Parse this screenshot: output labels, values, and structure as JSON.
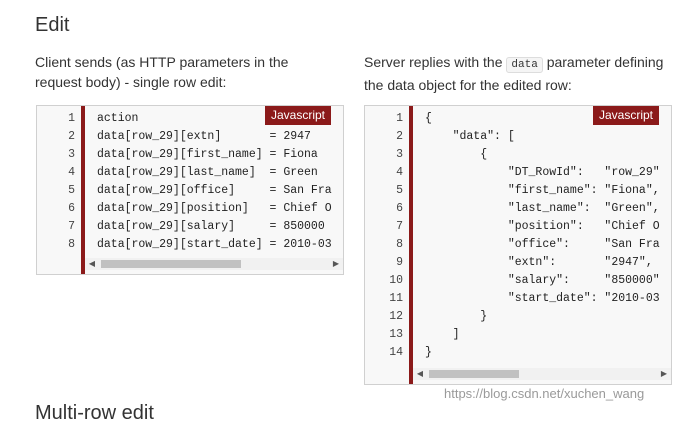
{
  "title": "Edit",
  "left": {
    "description": "Client sends (as HTTP parameters in the request body) - single row edit:",
    "badge": "Javascript",
    "lines": [
      {
        "n": "1",
        "t": "action"
      },
      {
        "n": "2",
        "t": "data[row_29][extn]       = 2947"
      },
      {
        "n": "3",
        "t": "data[row_29][first_name] = Fiona"
      },
      {
        "n": "4",
        "t": "data[row_29][last_name]  = Green"
      },
      {
        "n": "5",
        "t": "data[row_29][office]     = San Fra"
      },
      {
        "n": "6",
        "t": "data[row_29][position]   = Chief O"
      },
      {
        "n": "7",
        "t": "data[row_29][salary]     = 850000"
      },
      {
        "n": "8",
        "t": "data[row_29][start_date] = 2010-03"
      }
    ]
  },
  "right": {
    "description_pre": "Server replies with the ",
    "description_code": "data",
    "description_post": " parameter defining the data object for the edited row:",
    "badge": "Javascript",
    "lines": [
      {
        "n": "1",
        "t": "{"
      },
      {
        "n": "2",
        "t": "    \"data\": ["
      },
      {
        "n": "3",
        "t": "        {"
      },
      {
        "n": "4",
        "t": "            \"DT_RowId\":   \"row_29\""
      },
      {
        "n": "5",
        "t": "            \"first_name\": \"Fiona\","
      },
      {
        "n": "6",
        "t": "            \"last_name\":  \"Green\","
      },
      {
        "n": "7",
        "t": "            \"position\":   \"Chief O"
      },
      {
        "n": "8",
        "t": "            \"office\":     \"San Fra"
      },
      {
        "n": "9",
        "t": "            \"extn\":       \"2947\","
      },
      {
        "n": "10",
        "t": "            \"salary\":     \"850000\""
      },
      {
        "n": "11",
        "t": "            \"start_date\": \"2010-03"
      },
      {
        "n": "12",
        "t": "        }"
      },
      {
        "n": "13",
        "t": "    ]"
      },
      {
        "n": "14",
        "t": "}"
      }
    ]
  },
  "watermark": "https://blog.csdn.net/xuchen_wang",
  "next_heading_partial": "Multi-row edit"
}
